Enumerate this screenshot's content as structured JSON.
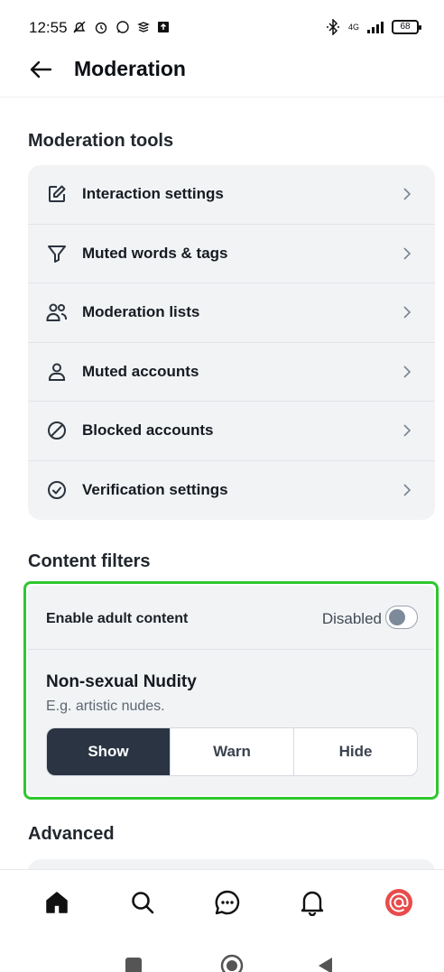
{
  "status_bar": {
    "time": "12:55",
    "network": "4G",
    "battery": "68"
  },
  "header": {
    "title": "Moderation"
  },
  "moderation_tools": {
    "title": "Moderation tools",
    "items": [
      {
        "label": "Interaction settings",
        "icon": "edit-icon"
      },
      {
        "label": "Muted words & tags",
        "icon": "filter-icon"
      },
      {
        "label": "Moderation lists",
        "icon": "users-icon"
      },
      {
        "label": "Muted accounts",
        "icon": "user-icon"
      },
      {
        "label": "Blocked accounts",
        "icon": "block-icon"
      },
      {
        "label": "Verification settings",
        "icon": "check-circle-icon"
      }
    ]
  },
  "content_filters": {
    "title": "Content filters",
    "adult": {
      "label": "Enable adult content",
      "state": "Disabled",
      "enabled": false
    },
    "nudity": {
      "title": "Non-sexual Nudity",
      "subtitle": "E.g. artistic nudes.",
      "options": [
        "Show",
        "Warn",
        "Hide"
      ],
      "selected": "Show"
    }
  },
  "advanced": {
    "title": "Advanced"
  },
  "tabbar": {
    "items": [
      "home-icon",
      "search-icon",
      "chat-icon",
      "bell-icon",
      "profile-avatar"
    ],
    "avatar_color": "#e94b4b"
  }
}
